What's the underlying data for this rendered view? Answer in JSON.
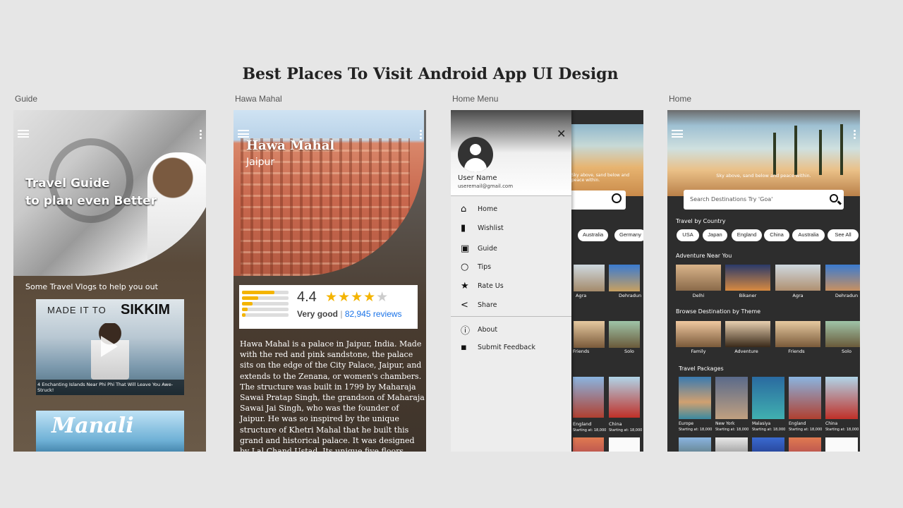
{
  "page": {
    "title": "Best Places To Visit Android App UI Design"
  },
  "labels": {
    "guide": "Guide",
    "hawa": "Hawa Mahal",
    "menu": "Home Menu",
    "home": "Home"
  },
  "guide": {
    "title_line1": "Travel Guide",
    "title_line2": "to plan even Better",
    "vlogs_caption": "Some Travel Vlogs to help you out",
    "video1": {
      "made_it": "MADE IT TO",
      "place": "SIKKIM",
      "caption": "4 Enchanting Islands Near Phi Phi That Will Leave You Awe-Struck!"
    },
    "video2": {
      "title": "Manali"
    }
  },
  "hawa": {
    "title": "Hawa Mahal",
    "subtitle": "Jaipur",
    "rating": {
      "value": "4.4",
      "stars": 4.4,
      "label": "Very good",
      "separator": "|",
      "reviews": "82,945 reviews",
      "bars": [
        0.7,
        0.35,
        0.22,
        0.12,
        0.08
      ]
    },
    "description": "Hawa Mahal is a palace in Jaipur, India. Made with the red and pink sandstone, the palace sits on the edge of the City Palace, Jaipur, and extends to the Zenana, or women's chambers. The structure was built in 1799 by Maharaja Sawai Pratap Singh, the grandson of Maharaja Sawai Jai Singh, who was the founder of Jaipur. He was so inspired by the unique structure of Khetri Mahal that he built this grand and historical palace. It was designed by Lal Chand Ustad. Its unique five floors exterior"
  },
  "menu": {
    "user_name": "User Name",
    "user_email": "useremail@gmail.com",
    "items": [
      {
        "label": "Home",
        "icon": "home-icon"
      },
      {
        "label": "Wishlist",
        "icon": "bookmark-icon"
      },
      {
        "label": "Guide",
        "icon": "video-library-icon"
      },
      {
        "label": "Tips",
        "icon": "lightbulb-icon"
      },
      {
        "label": "Rate Us",
        "icon": "star-icon"
      },
      {
        "label": "Share",
        "icon": "share-icon"
      }
    ],
    "secondary": [
      {
        "label": "About",
        "icon": "info-icon"
      },
      {
        "label": "Submit Feedback",
        "icon": "feedback-icon"
      }
    ],
    "bg": {
      "tagline": "Sky above, sand below and peace within.",
      "chips": [
        "Australia",
        "Germany"
      ],
      "adventure": [
        "Agra",
        "Dehradun"
      ],
      "themes": [
        "Friends",
        "Solo"
      ],
      "packages": [
        {
          "name": "England",
          "price": "Starting at: 18,000"
        },
        {
          "name": "China",
          "price": "Starting at: 18,000"
        }
      ]
    }
  },
  "home": {
    "tagline": "Sky above, sand below and peace within.",
    "search_placeholder": "Search Destinations Try 'Goa'",
    "sections": {
      "country": "Travel by Country",
      "adventure": "Adventure Near You",
      "theme": "Browse Destination by Theme",
      "packages": "Travel Packages"
    },
    "countries": [
      "USA",
      "Japan",
      "England",
      "China",
      "Australia",
      "See All"
    ],
    "adventure": [
      "Delhi",
      "Bikaner",
      "Agra",
      "Dehradun"
    ],
    "themes": [
      "Family",
      "Adventure",
      "Friends",
      "Solo"
    ],
    "packages": [
      {
        "name": "Europe",
        "price": "Starting at: 18,000"
      },
      {
        "name": "New York",
        "price": "Starting at: 18,000"
      },
      {
        "name": "Malasiya",
        "price": "Starting at: 18,000"
      },
      {
        "name": "England",
        "price": "Starting at: 18,000"
      },
      {
        "name": "China",
        "price": "Starting at: 18,000"
      }
    ]
  }
}
